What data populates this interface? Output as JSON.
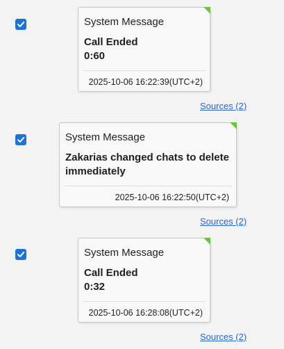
{
  "colors": {
    "checkbox_blue": "#1e73d1",
    "corner_tag_green": "#6ec04a",
    "link_blue": "#2b66c4"
  },
  "messages": [
    {
      "checked": true,
      "title": "System Message",
      "body_line1": "Call Ended",
      "body_line2": "0:60",
      "timestamp": "2025-10-06 16:22:39(UTC+2)",
      "sources": "Sources (2)"
    },
    {
      "checked": true,
      "title": "System Message",
      "body_line1": "Zakarias changed chats to delete",
      "body_line2": "immediately",
      "timestamp": "2025-10-06 16:22:50(UTC+2)",
      "sources": "Sources (2)"
    },
    {
      "checked": true,
      "title": "System Message",
      "body_line1": "Call Ended",
      "body_line2": "0:32",
      "timestamp": "2025-10-06 16:28:08(UTC+2)",
      "sources": "Sources (2)"
    }
  ]
}
